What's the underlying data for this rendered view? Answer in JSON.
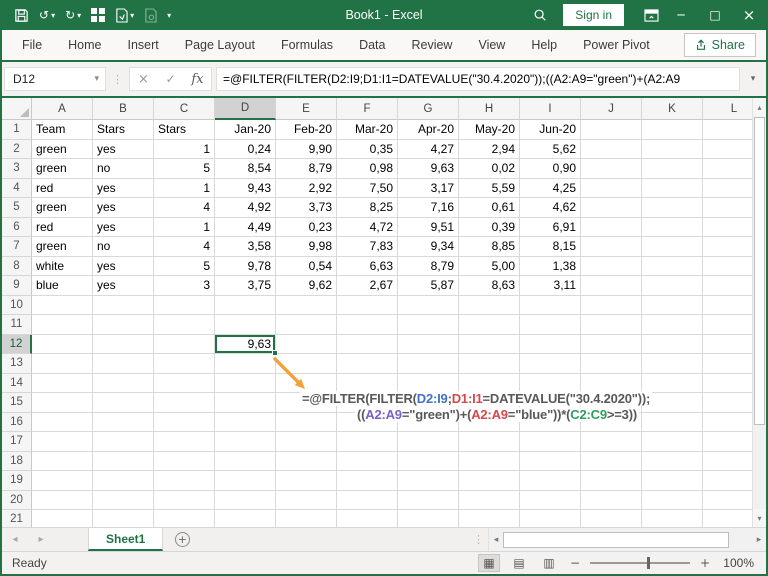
{
  "colors": {
    "excel_green": "#217346",
    "arrow_orange": "#F1A33B",
    "formula_base": "#595959",
    "formula_blue": "#4472C4",
    "formula_red": "#D6484B",
    "formula_purple": "#7B5FC7",
    "formula_green": "#2E9E5B"
  },
  "icons": {
    "undo": "↺",
    "redo": "↻",
    "caret_down": "▾",
    "ellipsis_v": "⋮",
    "check": "✓",
    "cancel": "×",
    "fx": "fx",
    "scroll_up": "▴",
    "scroll_down": "▾",
    "scroll_left": "◂",
    "scroll_right": "▸",
    "minimize": "─",
    "maximize": "□",
    "close": "×",
    "plus": "+",
    "minus": "−",
    "view_normal": "▦",
    "view_layout": "▤",
    "view_break": "▥"
  },
  "window": {
    "title": "Book1 - Excel",
    "sign_in": "Sign in"
  },
  "ribbon": {
    "tabs": [
      "File",
      "Home",
      "Insert",
      "Page Layout",
      "Formulas",
      "Data",
      "Review",
      "View",
      "Help",
      "Power Pivot"
    ],
    "share_label": "Share"
  },
  "formula_bar": {
    "name_box": "D12",
    "formula": "=@FILTER(FILTER(D2:I9;D1:I1=DATEVALUE(\"30.4.2020\"));((A2:A9=\"green\")+(A2:A9"
  },
  "grid": {
    "columns": [
      "A",
      "B",
      "C",
      "D",
      "E",
      "F",
      "G",
      "H",
      "I",
      "J",
      "K",
      "L"
    ],
    "total_rows": 21,
    "selected_column": "D",
    "selected_row": 12,
    "rows": [
      {
        "n": 1,
        "cells": [
          "Team",
          "Stars",
          "Stars",
          "Jan-20",
          "Feb-20",
          "Mar-20",
          "Apr-20",
          "May-20",
          "Jun-20"
        ],
        "align": [
          "l",
          "l",
          "l",
          "r",
          "r",
          "r",
          "r",
          "r",
          "r"
        ]
      },
      {
        "n": 2,
        "cells": [
          "green",
          "yes",
          "1",
          "0,24",
          "9,90",
          "0,35",
          "4,27",
          "2,94",
          "5,62"
        ],
        "align": [
          "l",
          "l",
          "r",
          "r",
          "r",
          "r",
          "r",
          "r",
          "r"
        ]
      },
      {
        "n": 3,
        "cells": [
          "green",
          "no",
          "5",
          "8,54",
          "8,79",
          "0,98",
          "9,63",
          "0,02",
          "0,90"
        ],
        "align": [
          "l",
          "l",
          "r",
          "r",
          "r",
          "r",
          "r",
          "r",
          "r"
        ]
      },
      {
        "n": 4,
        "cells": [
          "red",
          "yes",
          "1",
          "9,43",
          "2,92",
          "7,50",
          "3,17",
          "5,59",
          "4,25"
        ],
        "align": [
          "l",
          "l",
          "r",
          "r",
          "r",
          "r",
          "r",
          "r",
          "r"
        ]
      },
      {
        "n": 5,
        "cells": [
          "green",
          "yes",
          "4",
          "4,92",
          "3,73",
          "8,25",
          "7,16",
          "0,61",
          "4,62"
        ],
        "align": [
          "l",
          "l",
          "r",
          "r",
          "r",
          "r",
          "r",
          "r",
          "r"
        ]
      },
      {
        "n": 6,
        "cells": [
          "red",
          "yes",
          "1",
          "4,49",
          "0,23",
          "4,72",
          "9,51",
          "0,39",
          "6,91"
        ],
        "align": [
          "l",
          "l",
          "r",
          "r",
          "r",
          "r",
          "r",
          "r",
          "r"
        ]
      },
      {
        "n": 7,
        "cells": [
          "green",
          "no",
          "4",
          "3,58",
          "9,98",
          "7,83",
          "9,34",
          "8,85",
          "8,15"
        ],
        "align": [
          "l",
          "l",
          "r",
          "r",
          "r",
          "r",
          "r",
          "r",
          "r"
        ]
      },
      {
        "n": 8,
        "cells": [
          "white",
          "yes",
          "5",
          "9,78",
          "0,54",
          "6,63",
          "8,79",
          "5,00",
          "1,38"
        ],
        "align": [
          "l",
          "l",
          "r",
          "r",
          "r",
          "r",
          "r",
          "r",
          "r"
        ]
      },
      {
        "n": 9,
        "cells": [
          "blue",
          "yes",
          "3",
          "3,75",
          "9,62",
          "2,67",
          "5,87",
          "8,63",
          "3,11"
        ],
        "align": [
          "l",
          "l",
          "r",
          "r",
          "r",
          "r",
          "r",
          "r",
          "r"
        ]
      }
    ],
    "selected_cell": {
      "ref": "D12",
      "value": "9,63",
      "col_index": 3,
      "row": 12
    }
  },
  "annotation": {
    "line1": [
      {
        "text": "=@FILTER(FILTER(",
        "color": "formula_base"
      },
      {
        "text": "D2:I9",
        "color": "formula_blue"
      },
      {
        "text": ";",
        "color": "formula_base"
      },
      {
        "text": "D1:I1",
        "color": "formula_red"
      },
      {
        "text": "=DATEVALUE(\"30.4.2020\"));",
        "color": "formula_base"
      }
    ],
    "line2": [
      {
        "text": "((",
        "color": "formula_base"
      },
      {
        "text": "A2:A9",
        "color": "formula_purple"
      },
      {
        "text": "=\"green\")+(",
        "color": "formula_base"
      },
      {
        "text": "A2:A9",
        "color": "formula_red"
      },
      {
        "text": "=\"blue\"))*(",
        "color": "formula_base"
      },
      {
        "text": "C2:C9",
        "color": "formula_green"
      },
      {
        "text": ">=3))",
        "color": "formula_base"
      }
    ]
  },
  "sheet_bar": {
    "tabs": [
      {
        "label": "Sheet1",
        "active": true
      }
    ]
  },
  "status_bar": {
    "status": "Ready",
    "zoom_level": "100%"
  }
}
